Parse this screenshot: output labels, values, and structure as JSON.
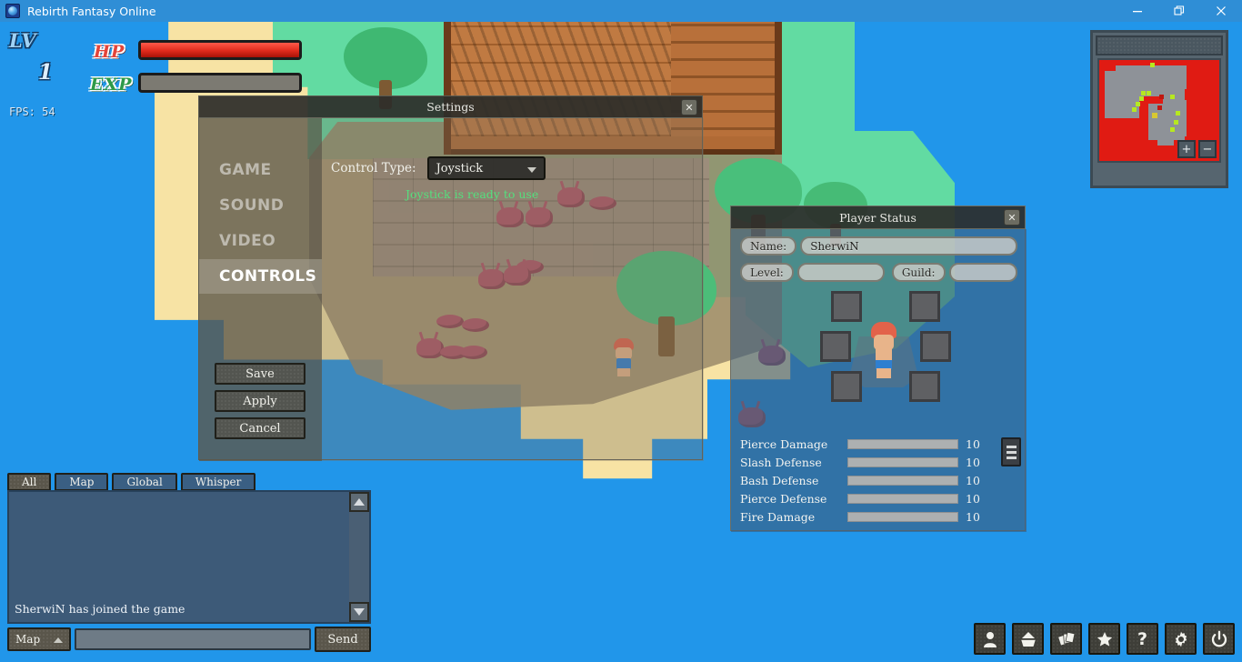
{
  "window": {
    "title": "Rebirth Fantasy Online",
    "app_icon": "orb-icon",
    "minimize_label": "—",
    "restore_label": "❐",
    "close_label": "✕"
  },
  "hud": {
    "level_label": "LV",
    "level_value": "1",
    "hp_label": "HP",
    "exp_label": "EXP",
    "hp_percent": 100,
    "exp_percent": 0,
    "fps": "FPS: 54"
  },
  "settings": {
    "title": "Settings",
    "close_label": "✕",
    "tabs": [
      {
        "label": "GAME",
        "active": false
      },
      {
        "label": "SOUND",
        "active": false
      },
      {
        "label": "VIDEO",
        "active": false
      },
      {
        "label": "CONTROLS",
        "active": true
      }
    ],
    "control_type_label": "Control Type:",
    "control_type_value": "Joystick",
    "control_status": "Joystick is ready to use",
    "status_color": "#54e07e",
    "buttons": [
      {
        "label": "Save"
      },
      {
        "label": "Apply"
      },
      {
        "label": "Cancel"
      }
    ]
  },
  "player_status": {
    "title": "Player Status",
    "close_label": "✕",
    "name_label": "Name:",
    "name_value": "SherwiN",
    "level_label": "Level:",
    "level_value": "",
    "guild_label": "Guild:",
    "guild_value": "",
    "equipment_slots": 6,
    "stats": [
      {
        "name": "Pierce Damage",
        "value": "10"
      },
      {
        "name": "Slash Defense",
        "value": "10"
      },
      {
        "name": "Bash Defense",
        "value": "10"
      },
      {
        "name": "Pierce Defense",
        "value": "10"
      },
      {
        "name": "Fire Damage",
        "value": "10"
      }
    ],
    "menu_icon": "list-menu-icon"
  },
  "chat": {
    "tabs": [
      {
        "label": "All",
        "active": true
      },
      {
        "label": "Map",
        "active": false
      },
      {
        "label": "Global",
        "active": false
      },
      {
        "label": "Whisper",
        "active": false
      }
    ],
    "messages": [
      "SherwiN has joined the game"
    ],
    "channel_value": "Map",
    "input_value": "",
    "input_placeholder": "",
    "send_label": "Send",
    "scroll_up_icon": "triangle-up-icon",
    "scroll_down_icon": "triangle-down-icon"
  },
  "minimap": {
    "zoom_in_label": "+",
    "zoom_out_label": "−",
    "background_color": "#e01b13",
    "land_color": "#8e9298",
    "marker_color": "#b6e820"
  },
  "iconbar": [
    {
      "name": "character-icon",
      "label": "Character"
    },
    {
      "name": "inventory-icon",
      "label": "Inventory"
    },
    {
      "name": "skills-icon",
      "label": "Skills"
    },
    {
      "name": "star-icon",
      "label": "Favorites"
    },
    {
      "name": "help-icon",
      "label": "?"
    },
    {
      "name": "settings-gear-icon",
      "label": "Settings"
    },
    {
      "name": "power-icon",
      "label": "Exit"
    }
  ]
}
